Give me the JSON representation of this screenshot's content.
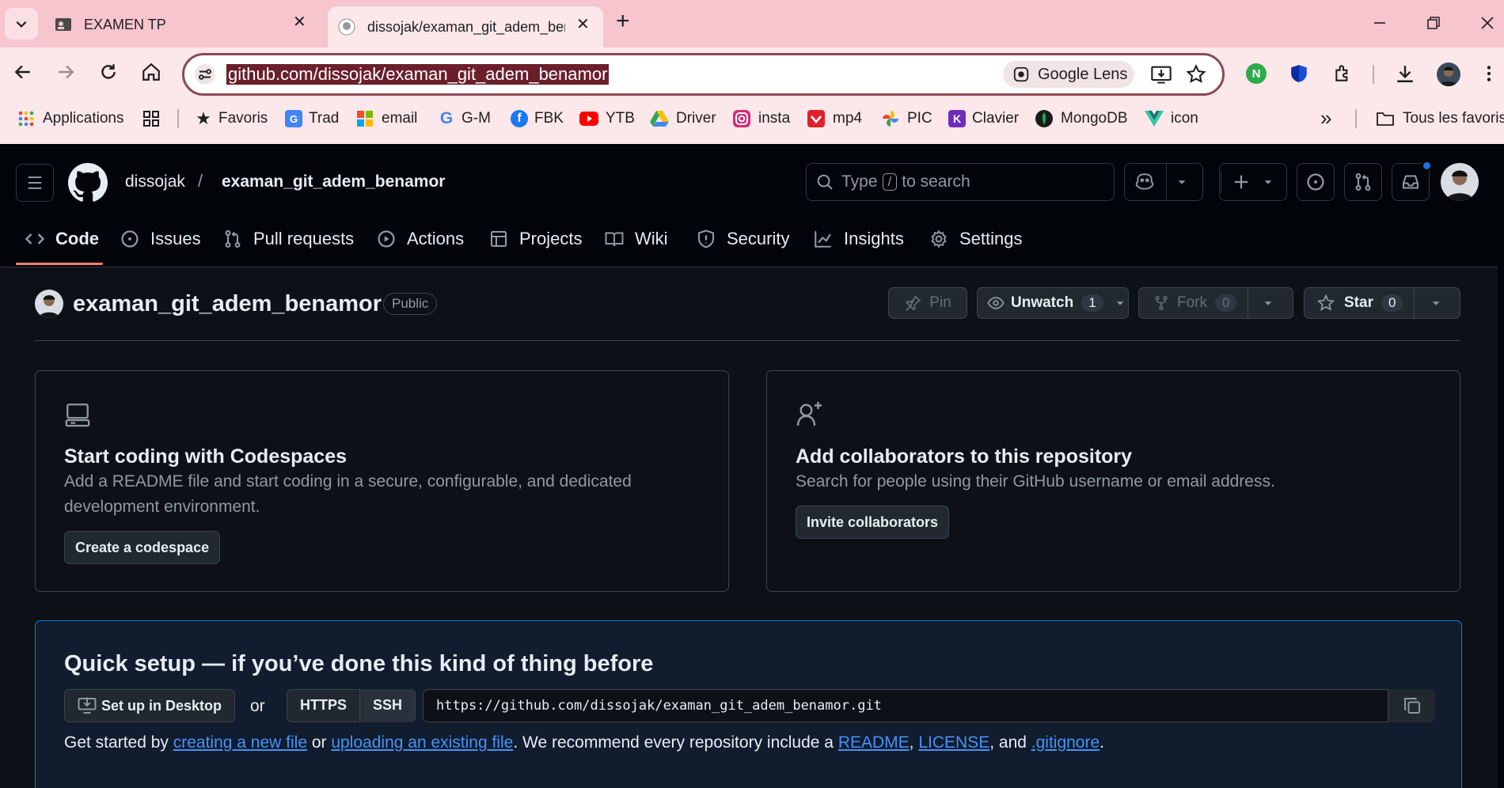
{
  "browser": {
    "tabs": [
      {
        "title": "EXAMEN TP",
        "active": false
      },
      {
        "title": "dissojak/examan_git_adem_ben",
        "active": true
      }
    ],
    "url": "github.com/dissojak/examan_git_adem_benamor",
    "lens_label": "Google Lens",
    "bookmarks": [
      {
        "label": "Applications",
        "icon": "apps-grid-icon"
      },
      {
        "label": "Favoris",
        "icon": "star-icon"
      },
      {
        "label": "Trad",
        "icon": "translate-icon"
      },
      {
        "label": "email",
        "icon": "microsoft-icon"
      },
      {
        "label": "G-M",
        "icon": "google-icon"
      },
      {
        "label": "FBK",
        "icon": "facebook-icon"
      },
      {
        "label": "YTB",
        "icon": "youtube-icon"
      },
      {
        "label": "Driver",
        "icon": "drive-icon"
      },
      {
        "label": "insta",
        "icon": "instagram-icon"
      },
      {
        "label": "mp4",
        "icon": "download-icon"
      },
      {
        "label": "PIC",
        "icon": "pinwheel-icon"
      },
      {
        "label": "Clavier",
        "icon": "keyboard-icon"
      },
      {
        "label": "MongoDB",
        "icon": "mongodb-icon"
      },
      {
        "label": "icon",
        "icon": "vue-icon"
      }
    ],
    "all_bookmarks": "Tous les favoris"
  },
  "github": {
    "owner": "dissojak",
    "separator": "/",
    "repo": "examan_git_adem_benamor",
    "search_pre": "Type",
    "search_key": "/",
    "search_post": "to search",
    "nav": [
      {
        "label": "Code",
        "icon": "code-icon",
        "selected": true
      },
      {
        "label": "Issues",
        "icon": "issue-icon"
      },
      {
        "label": "Pull requests",
        "icon": "pull-request-icon"
      },
      {
        "label": "Actions",
        "icon": "play-icon"
      },
      {
        "label": "Projects",
        "icon": "table-icon"
      },
      {
        "label": "Wiki",
        "icon": "book-icon"
      },
      {
        "label": "Security",
        "icon": "shield-icon"
      },
      {
        "label": "Insights",
        "icon": "graph-icon"
      },
      {
        "label": "Settings",
        "icon": "gear-icon"
      }
    ],
    "visibility": "Public",
    "pin": "Pin",
    "unwatch": "Unwatch",
    "watch_count": "1",
    "fork": "Fork",
    "fork_count": "0",
    "star": "Star",
    "star_count": "0",
    "codespaces": {
      "title": "Start coding with Codespaces",
      "desc": "Add a README file and start coding in a secure, configurable, and dedicated development environment.",
      "button": "Create a codespace"
    },
    "collaborators": {
      "title": "Add collaborators to this repository",
      "desc": "Search for people using their GitHub username or email address.",
      "button": "Invite collaborators"
    },
    "quick_setup": {
      "title": "Quick setup — if you’ve done this kind of thing before",
      "desktop": "Set up in Desktop",
      "or": "or",
      "https": "HTTPS",
      "ssh": "SSH",
      "clone_url": "https://github.com/dissojak/examan_git_adem_benamor.git",
      "t1": "Get started by ",
      "l1": "creating a new file",
      "t2": " or ",
      "l2": "uploading an existing file",
      "t3": ". We recommend every repository include a ",
      "l3": "README",
      "t4": ", ",
      "l4": "LICENSE",
      "t5": ", and ",
      "l5": ".gitignore",
      "t6": "."
    }
  }
}
